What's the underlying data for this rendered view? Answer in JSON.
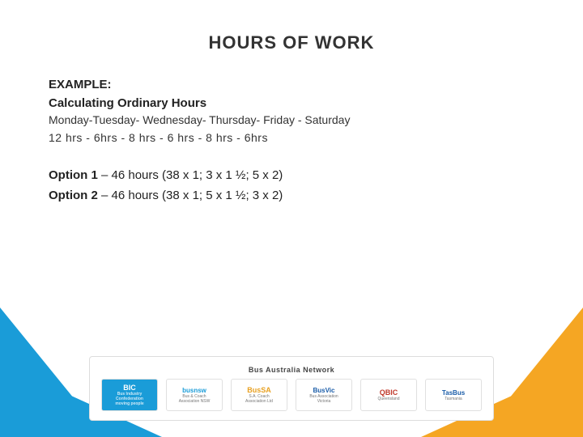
{
  "header": {
    "title": "HOURS OF WORK"
  },
  "content": {
    "example_label": "EXAMPLE:",
    "section_heading": "Calculating Ordinary Hours",
    "days_row": "Monday-Tuesday-  Wednesday-  Thursday-  Friday  -  Saturday",
    "hours_row": "12 hrs  -  6hrs     -   8 hrs      -    6 hrs       -    8 hrs  -   6hrs",
    "option1": "Option 1",
    "option1_separator": " – ",
    "option1_detail": "46 hours (38 x 1; 3 x 1 ½; 5 x 2)",
    "option2": "Option 2",
    "option2_separator": " – ",
    "option2_detail": "46 hours (38 x 1; 5 x 1 ½; 3 x 2)"
  },
  "logo_bar": {
    "title": "Bus Australia Network",
    "logos": [
      {
        "id": "bic",
        "main": "BIC",
        "sub": "Bus Industry Confederation\nmoving people"
      },
      {
        "id": "busnsw",
        "main": "busnsw",
        "sub": "Bus & Coach Association NSW"
      },
      {
        "id": "bussd",
        "main": "BusSA",
        "sub": "The S.A. Coach Association Ltd"
      },
      {
        "id": "busvic",
        "main": "BusVic",
        "sub": "Bus Association Victoria"
      },
      {
        "id": "qbic",
        "main": "QBIC",
        "sub": ""
      },
      {
        "id": "tasbus",
        "main": "TasBus",
        "sub": ""
      }
    ]
  },
  "colors": {
    "blue": "#1a9cd8",
    "orange": "#f5a623",
    "text_dark": "#222222"
  }
}
